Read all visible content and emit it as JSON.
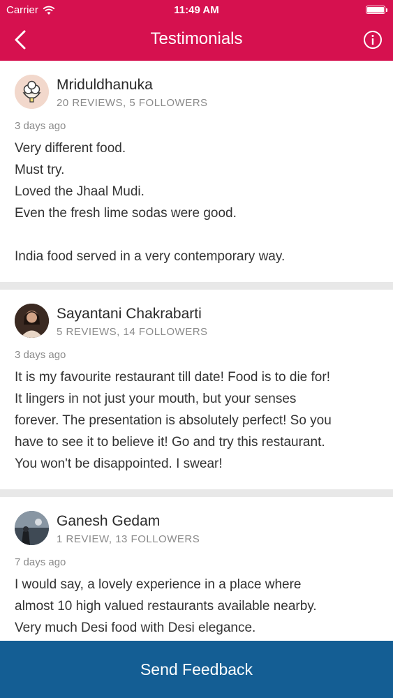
{
  "status_bar": {
    "carrier": "Carrier",
    "time": "11:49 AM"
  },
  "nav": {
    "title": "Testimonials",
    "back_icon": "chevron-left-icon",
    "info_icon": "info-circle-icon"
  },
  "colors": {
    "header": "#d6114f",
    "footer": "#145e94"
  },
  "reviews": [
    {
      "name": "Mriduldhanuka",
      "meta": "20 REVIEWS, 5 FOLLOWERS",
      "date": "3 days ago",
      "lines": [
        "Very different food.",
        "Must try.",
        "Loved the Jhaal Mudi.",
        "Even the fresh lime sodas were good.",
        "",
        "India food served in a very contemporary way."
      ]
    },
    {
      "name": "Sayantani Chakrabarti",
      "meta": "5 REVIEWS, 14 FOLLOWERS",
      "date": "3 days ago",
      "lines": [
        "It is my favourite restaurant till date! Food is to die for!",
        "It lingers in not just your mouth, but your senses",
        "forever. The presentation is absolutely perfect! So you",
        "have to see it to believe it! Go and try this restaurant.",
        "You won't be disappointed. I swear!"
      ]
    },
    {
      "name": "Ganesh Gedam",
      "meta": "1 REVIEW, 13 FOLLOWERS",
      "date": "7 days ago",
      "lines": [
        "I would say, a lovely experience in a place where",
        "almost 10 high valued restaurants available nearby.",
        "Very much Desi food with Desi elegance."
      ]
    }
  ],
  "footer": {
    "button_label": "Send Feedback"
  }
}
